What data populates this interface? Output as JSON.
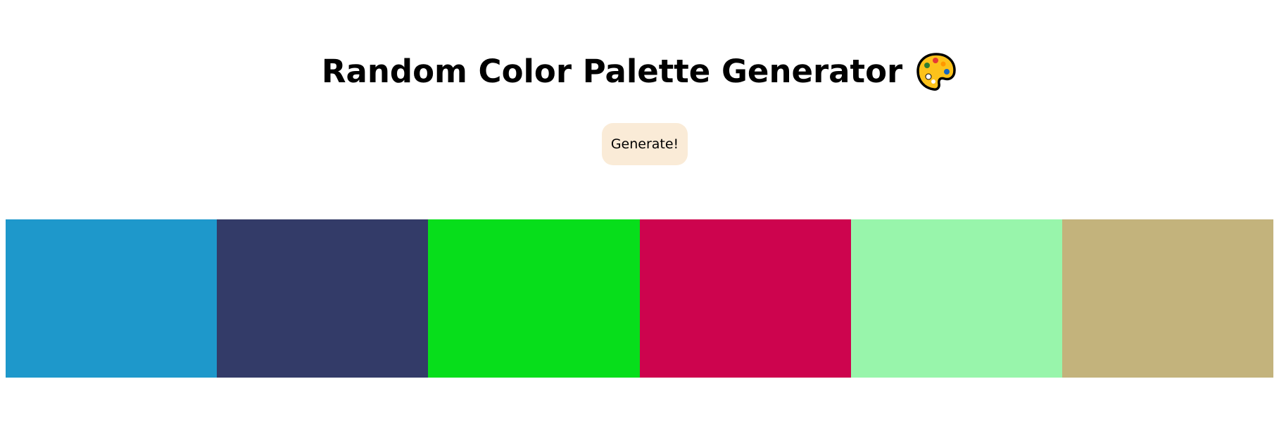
{
  "header": {
    "title": "Random Color Palette Generator",
    "icon": "artist-palette-icon"
  },
  "actions": {
    "generate_label": "Generate!"
  },
  "palette": {
    "swatches": [
      {
        "color": "#1e98cb"
      },
      {
        "color": "#333b68"
      },
      {
        "color": "#07de1b"
      },
      {
        "color": "#cd044e"
      },
      {
        "color": "#98f5ab"
      },
      {
        "color": "#c3b37c"
      }
    ]
  }
}
